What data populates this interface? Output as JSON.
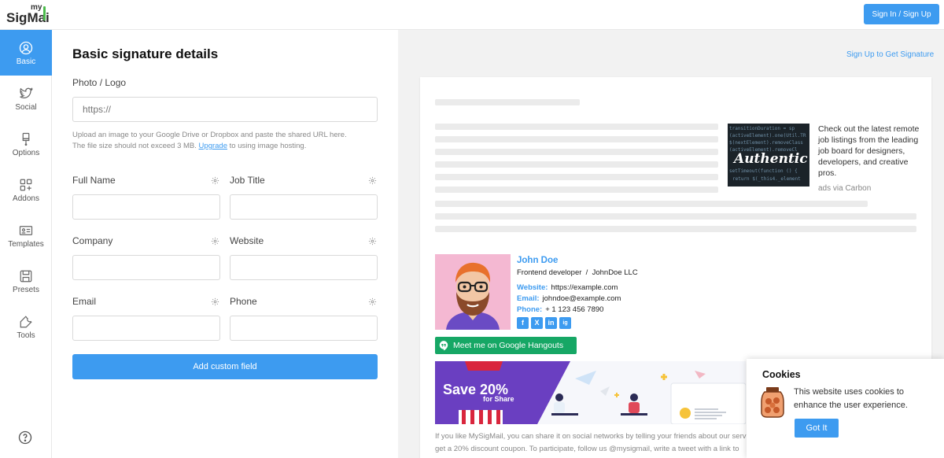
{
  "header": {
    "logo_small": "my",
    "logo_main": "SigMai",
    "signin_label": "Sign In / Sign Up"
  },
  "sidebar": {
    "items": [
      {
        "label": "Basic",
        "icon": "user-circle-icon",
        "active": true
      },
      {
        "label": "Social",
        "icon": "twitter-icon"
      },
      {
        "label": "Options",
        "icon": "brush-icon"
      },
      {
        "label": "Addons",
        "icon": "apps-plus-icon"
      },
      {
        "label": "Templates",
        "icon": "template-card-icon"
      },
      {
        "label": "Presets",
        "icon": "save-icon"
      },
      {
        "label": "Tools",
        "icon": "wrench-icon"
      }
    ],
    "help_icon": "question-circle-icon"
  },
  "form": {
    "title": "Basic signature details",
    "photo_label": "Photo / Logo",
    "photo_placeholder": "https://",
    "hint_line1": "Upload an image to your Google Drive or Dropbox and paste the shared URL here.",
    "hint_line2_pre": "The file size should not exceed 3 MB.",
    "hint_link": "Upgrade",
    "hint_line2_post": "to using image hosting.",
    "fields": {
      "full_name": "Full Name",
      "job_title": "Job Title",
      "company": "Company",
      "website": "Website",
      "email": "Email",
      "phone": "Phone"
    },
    "add_custom_label": "Add custom field"
  },
  "preview": {
    "signup_link": "Sign Up to Get Signature",
    "carbon_text": "Check out the latest remote job listings from the leading job board for designers, developers, and creative pros.",
    "carbon_via": "ads via Carbon",
    "carbon_image_word": "Authentic",
    "signature": {
      "name": "John Doe",
      "job": "Frontend developer",
      "separator": "/",
      "company": "JohnDoe LLC",
      "website_label": "Website:",
      "website": "https://example.com",
      "email_label": "Email:",
      "email": "johndoe@example.com",
      "phone_label": "Phone:",
      "phone": "+ 1 123 456 7890",
      "social": [
        "f",
        "X",
        "in",
        "ig"
      ],
      "hangouts_label": "Meet me on Google Hangouts"
    },
    "banner": {
      "headline": "Save 20%",
      "sub": "for Share"
    },
    "share_line1": "If you like MySigMail, you can share it on social networks by telling your friends about our serv",
    "share_line2": "get a 20% discount coupon. To participate, follow us @mysigmail, write a tweet with a link to"
  },
  "cookies": {
    "title": "Cookies",
    "text": "This website uses cookies to enhance the user experience.",
    "button": "Got It"
  },
  "colors": {
    "accent": "#3d9bf0",
    "hangouts_green": "#16a765",
    "avatar_bg": "#f4b8d2"
  }
}
